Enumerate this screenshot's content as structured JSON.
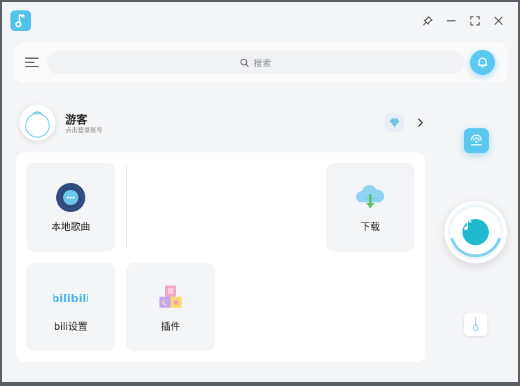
{
  "app": {
    "logo_icon": "music-note-logo-icon",
    "accent_color": "#5cc8f0"
  },
  "window_controls": {
    "pin_icon": "pin-icon",
    "minimize_icon": "minimize-icon",
    "maximize_icon": "fullscreen-icon",
    "close_icon": "close-icon"
  },
  "topbar": {
    "menu_icon": "menu-icon",
    "search_placeholder": "搜索",
    "bell_icon": "bell-icon"
  },
  "user": {
    "name": "游客",
    "subtitle": "点击登录账号",
    "vip_icon": "diamond-icon"
  },
  "tiles": {
    "local_songs": {
      "label": "本地歌曲",
      "icon": "local-disc-icon"
    },
    "download": {
      "label": "下载",
      "icon": "cloud-download-icon"
    },
    "bili_settings": {
      "label": "bili设置",
      "logo_text": "bilibili",
      "icon": "bilibili-logo"
    },
    "plugins": {
      "label": "插件",
      "icon": "building-blocks-icon"
    }
  },
  "side": {
    "radio_icon": "radio-wave-icon",
    "player_icon": "music-note-icon",
    "mini_icon": "guitar-icon"
  }
}
